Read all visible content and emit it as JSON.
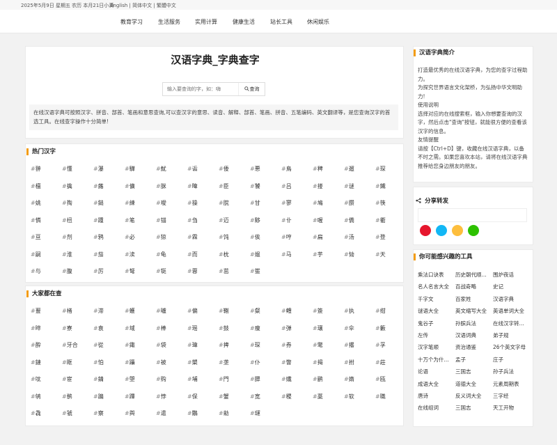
{
  "topbar": {
    "date": "2025年5月9日 星期五 农历 本月21日小满",
    "lang_en": "English",
    "lang_sep1": " | ",
    "lang_cn_simple": "简体中文",
    "lang_sep2": " | ",
    "lang_cn_trad": "繁體中文"
  },
  "nav": [
    "教育学习",
    "生活服务",
    "实用计算",
    "健康生活",
    "站长工具",
    "休闲娱乐"
  ],
  "main": {
    "title": "汉语字典_字典查字",
    "search_placeholder": "输入要查询的字，如：嗨",
    "search_button": "查询",
    "intro": "在线汉语字典可按照汉字、拼音、部首、笔画和意思查询,可以查汉字的意思、读音、解释、部首、笔画、拼音、五笔编码、英文翻译等，是您查询汉字的首选工具。在线查字操作十分简单!"
  },
  "hot": {
    "title": "热门汉字",
    "chars": [
      "翀",
      "懂",
      "瀑",
      "驊",
      "魷",
      "诟",
      "倭",
      "悪",
      "鳥",
      "稗",
      "遛",
      "琛",
      "檀",
      "擒",
      "蕗",
      "儣",
      "脒",
      "暐",
      "臣",
      "饕",
      "吕",
      "搂",
      "谜",
      "鐵",
      "姚",
      "掏",
      "鎚",
      "練",
      "璦",
      "操",
      "脘",
      "甘",
      "寥",
      "鳩",
      "臜",
      "筷",
      "憐",
      "杻",
      "踵",
      "笔",
      "锚",
      "刍",
      "迈",
      "黟",
      "卝",
      "喔",
      "僑",
      "衢",
      "亘",
      "剂",
      "鸦",
      "必",
      "猄",
      "霖",
      "饨",
      "俟",
      "哼",
      "扁",
      "汤",
      "登",
      "嗣",
      "淮",
      "茄",
      "渎",
      "龟",
      "而",
      "枕",
      "媪",
      "马",
      "芋",
      "恸",
      "天",
      "与",
      "腹",
      "厉",
      "弩",
      "铤",
      "蓉",
      "茁",
      "鲎"
    ]
  },
  "common": {
    "title": "大家都在查",
    "chars": [
      "蘴",
      "楮",
      "滞",
      "蠖",
      "曥",
      "偏",
      "鞩",
      "粲",
      "鳢",
      "簽",
      "执",
      "绀",
      "晬",
      "寮",
      "袁",
      "域",
      "棒",
      "瑶",
      "鼓",
      "痩",
      "弹",
      "瓖",
      "伞",
      "籔",
      "酔",
      "牙合",
      "從",
      "鋷",
      "袋",
      "瑋",
      "捭",
      "琛",
      "券",
      "氅",
      "撂",
      "孚",
      "鏈",
      "眶",
      "怕",
      "躡",
      "被",
      "槊",
      "垄",
      "仆",
      "瞥",
      "揭",
      "拊",
      "莊",
      "呔",
      "宦",
      "錆",
      "塱",
      "购",
      "埔",
      "門",
      "臎",
      "孅",
      "鹂",
      "媠",
      "瓯",
      "鸲",
      "鹡",
      "蹁",
      "蹕",
      "悖",
      "保",
      "蟹",
      "宽",
      "稷",
      "藁",
      "软",
      "職",
      "毳",
      "虢",
      "察",
      "舆",
      "遣",
      "鷳",
      "勑",
      "璭"
    ]
  },
  "sidebar": {
    "intro_title": "汉语字典简介",
    "intro_lines": [
      "打造最优秀的在线汉语字典，为您的查字过程助力。",
      "为探究世界语言文化架桥，为弘扬中华文明助力!",
      "使用说明",
      "选择对应的在线搜索框，输入你想要查询的汉字，然后点击\"查询\"按钮，就能很方便的查看该汉字的信息。",
      "友情提醒",
      "请按【Ctrl+D】键，收藏在线汉语字典，以备不时之需。如果您喜欢本站，请将在线汉语字典推荐给您身边朋友的朋友。"
    ],
    "share_title": "分享转发",
    "share_icons": [
      "weibo-icon",
      "qq-icon",
      "qzone-icon",
      "wechat-icon"
    ],
    "share_colors": [
      "#e6162d",
      "#12b7f5",
      "#fdbe3d",
      "#2dc100"
    ],
    "tools_title": "你可能感兴趣的工具",
    "tools": [
      "乘法口诀表",
      "历史朝代顺...",
      "围炉夜话",
      "名人名言大全",
      "百战奇略",
      "史记",
      "千字文",
      "百家姓",
      "汉语字典",
      "谜语大全",
      "英文缩写大全",
      "英语单词大全",
      "鬼谷子",
      "孙膑兵法",
      "在线汉字转...",
      "左传",
      "汉语词典",
      "弟子规",
      "汉字笔顺",
      "资治通鉴",
      "26个英文字母",
      "十万个为什...",
      "孟子",
      "庄子",
      "论语",
      "三国志",
      "孙子兵法",
      "成语大全",
      "道德大全",
      "元素周期表",
      "唐诗",
      "反义词大全",
      "三字经",
      "在线组词",
      "三国志",
      "天工开物"
    ]
  },
  "colors": {
    "accent": "#f39c12"
  }
}
